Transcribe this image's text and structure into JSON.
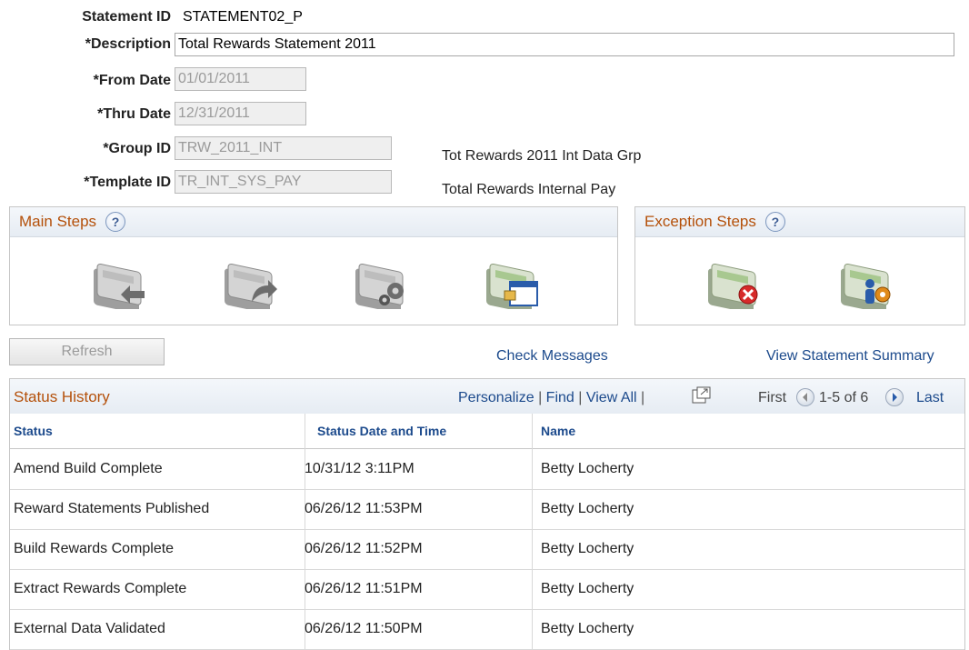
{
  "form": {
    "statement_id_label": "Statement ID",
    "statement_id_value": "STATEMENT02_P",
    "description_label": "*Description",
    "description_value": "Total Rewards Statement 2011",
    "from_date_label": "*From Date",
    "from_date_value": "01/01/2011",
    "thru_date_label": "*Thru Date",
    "thru_date_value": "12/31/2011",
    "group_id_label": "*Group ID",
    "group_id_value": "TRW_2011_INT",
    "group_id_desc": "Tot Rewards 2011 Int Data Grp",
    "template_id_label": "*Template ID",
    "template_id_value": "TR_INT_SYS_PAY",
    "template_id_desc": "Total Rewards Internal Pay"
  },
  "main_steps": {
    "title": "Main Steps",
    "help": "?",
    "icons": [
      "extract-rewards-icon",
      "validate-data-icon",
      "build-rewards-icon",
      "publish-statements-icon"
    ]
  },
  "exception_steps": {
    "title": "Exception Steps",
    "help": "?",
    "icons": [
      "delete-statements-icon",
      "process-exceptions-icon"
    ]
  },
  "actions": {
    "refresh": "Refresh",
    "check_messages": "Check Messages",
    "view_summary": "View Statement Summary"
  },
  "status_history": {
    "title": "Status History",
    "personalize": "Personalize",
    "find": "Find",
    "view_all": "View All",
    "sep": "|",
    "first": "First",
    "range": "1-5 of 6",
    "last": "Last",
    "columns": [
      "Status",
      "Status Date and Time",
      "Name"
    ],
    "rows": [
      {
        "status": "Amend Build Complete",
        "datetime": "10/31/12  3:11PM",
        "name": "Betty Locherty"
      },
      {
        "status": "Reward Statements Published",
        "datetime": "06/26/12 11:53PM",
        "name": "Betty Locherty"
      },
      {
        "status": "Build Rewards Complete",
        "datetime": "06/26/12 11:52PM",
        "name": "Betty Locherty"
      },
      {
        "status": "Extract Rewards Complete",
        "datetime": "06/26/12 11:51PM",
        "name": "Betty Locherty"
      },
      {
        "status": "External Data Validated",
        "datetime": "06/26/12 11:50PM",
        "name": "Betty Locherty"
      }
    ]
  },
  "colors": {
    "section_title": "#b4500a",
    "link": "#1c4a8c",
    "border": "#c6c6c6"
  }
}
